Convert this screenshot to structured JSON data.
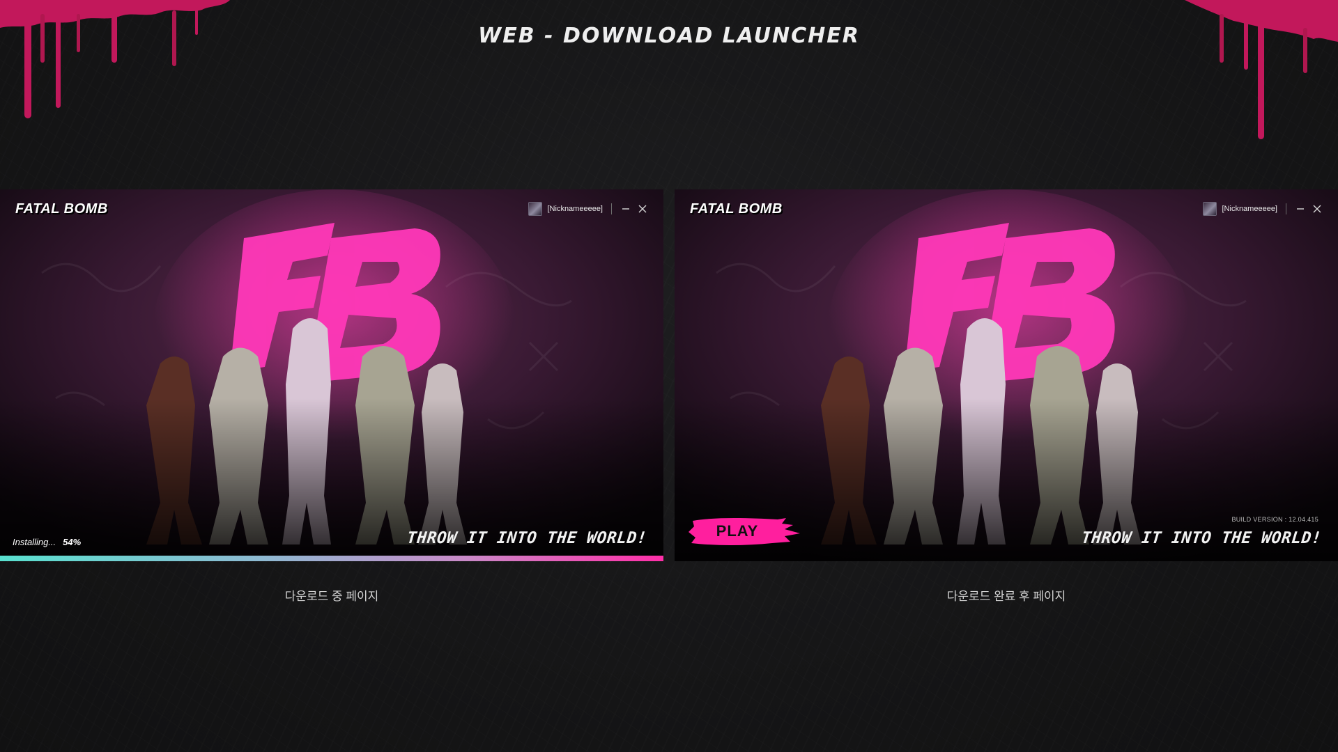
{
  "page": {
    "title": "WEB - DOWNLOAD LAUNCHER",
    "accent_color": "#ff2fa8"
  },
  "launcher_downloading": {
    "logo": "FATAL BOMB",
    "nickname": "[Nicknameeeee]",
    "slogan": "THROW IT INTO THE WORLD!",
    "status_label": "Installing...",
    "progress_text": "54%",
    "progress_value": 0.54,
    "caption": "다운로드 중 페이지"
  },
  "launcher_complete": {
    "logo": "FATAL BOMB",
    "nickname": "[Nicknameeeee]",
    "slogan": "THROW IT INTO THE WORLD!",
    "build_version": "BUILD VERSION : 12.04.415",
    "play_label": "PLAY",
    "caption": "다운로드 완료 후 페이지"
  },
  "icons": {
    "minimize": "minimize-icon",
    "close": "close-icon",
    "avatar": "avatar"
  }
}
